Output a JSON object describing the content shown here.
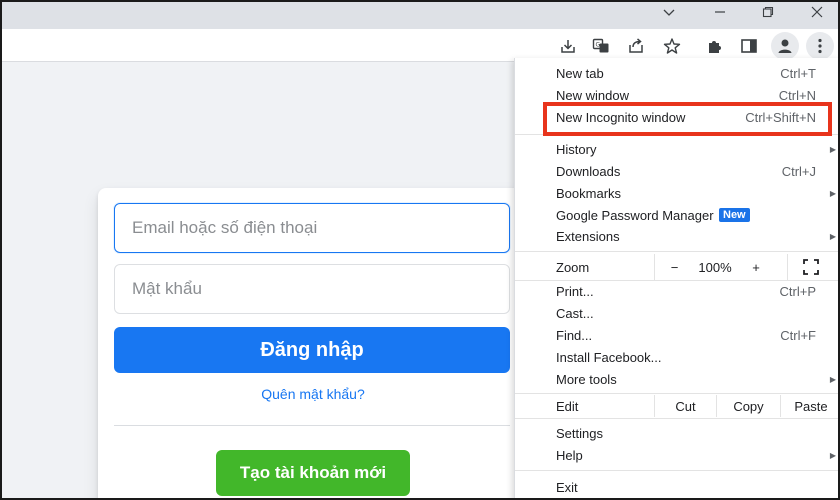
{
  "browser": {
    "window_controls": [
      "chevron-down-icon",
      "minimize-icon",
      "restore-icon",
      "close-icon"
    ],
    "toolbar_icons": [
      "install-icon",
      "translate-icon",
      "share-icon",
      "star-icon",
      "extensions-icon",
      "side-panel-icon",
      "profile-icon",
      "more-icon"
    ]
  },
  "login": {
    "email_placeholder": "Email hoặc số điện thoại",
    "password_placeholder": "Mật khẩu",
    "login_button": "Đăng nhập",
    "forgot_link": "Quên mật khẩu?",
    "create_account_button": "Tạo tài khoản mới"
  },
  "menu": {
    "new_tab": {
      "label": "New tab",
      "shortcut": "Ctrl+T"
    },
    "new_window": {
      "label": "New window",
      "shortcut": "Ctrl+N"
    },
    "new_incognito": {
      "label": "New Incognito window",
      "shortcut": "Ctrl+Shift+N"
    },
    "history": {
      "label": "History"
    },
    "downloads": {
      "label": "Downloads",
      "shortcut": "Ctrl+J"
    },
    "bookmarks": {
      "label": "Bookmarks"
    },
    "password_manager": {
      "label": "Google Password Manager",
      "badge": "New"
    },
    "extensions": {
      "label": "Extensions"
    },
    "zoom": {
      "label": "Zoom",
      "minus": "−",
      "value": "100%",
      "plus": "+"
    },
    "print": {
      "label": "Print...",
      "shortcut": "Ctrl+P"
    },
    "cast": {
      "label": "Cast..."
    },
    "find": {
      "label": "Find...",
      "shortcut": "Ctrl+F"
    },
    "install": {
      "label": "Install Facebook..."
    },
    "more_tools": {
      "label": "More tools"
    },
    "edit": {
      "label": "Edit",
      "cut": "Cut",
      "copy": "Copy",
      "paste": "Paste"
    },
    "settings": {
      "label": "Settings"
    },
    "help": {
      "label": "Help"
    },
    "exit": {
      "label": "Exit"
    }
  },
  "colors": {
    "highlight": "#e8341c",
    "facebook_blue": "#1877f2",
    "facebook_green": "#42b72a",
    "chrome_badge": "#1a73e8"
  }
}
